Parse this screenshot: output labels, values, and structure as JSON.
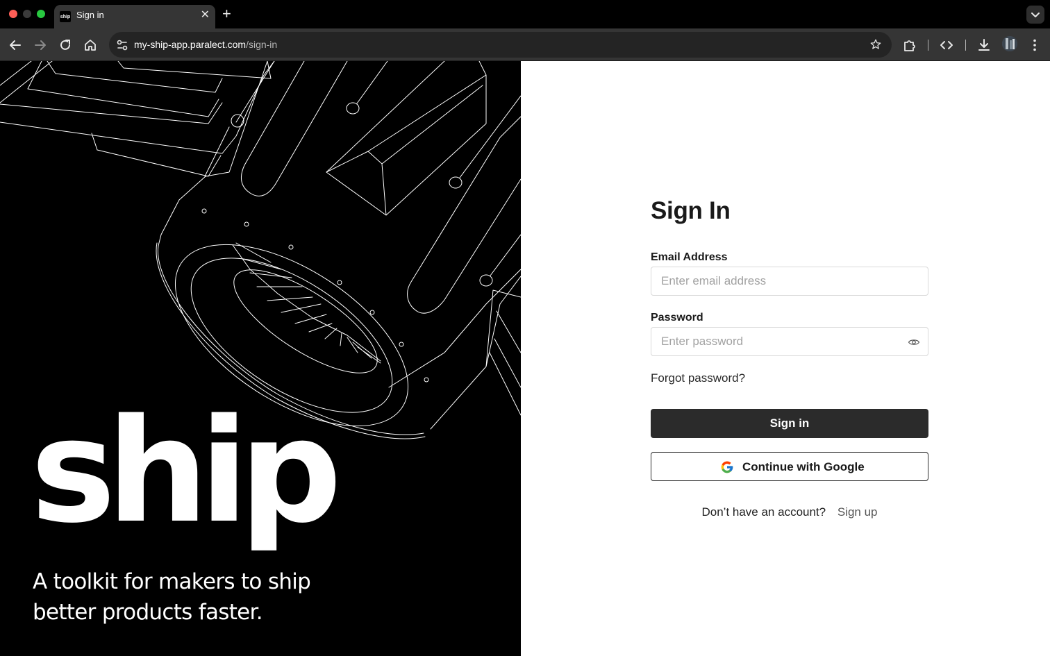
{
  "browser": {
    "tab_title": "Sign in",
    "tab_favicon_text": "ship",
    "url_host": "my-ship-app.paralect.com",
    "url_path": "/sign-in"
  },
  "hero": {
    "logo": "ship",
    "tagline": "A toolkit for makers to ship better products faster."
  },
  "form": {
    "title": "Sign In",
    "email_label": "Email Address",
    "email_placeholder": "Enter email address",
    "password_label": "Password",
    "password_placeholder": "Enter password",
    "forgot_label": "Forgot password?",
    "sign_in_label": "Sign in",
    "google_label": "Continue with Google",
    "signup_question": "Don’t have an account?",
    "signup_link": "Sign up"
  },
  "colors": {
    "primary_button": "#2b2b2b",
    "hero_background": "#000000",
    "page_background": "#ffffff"
  }
}
